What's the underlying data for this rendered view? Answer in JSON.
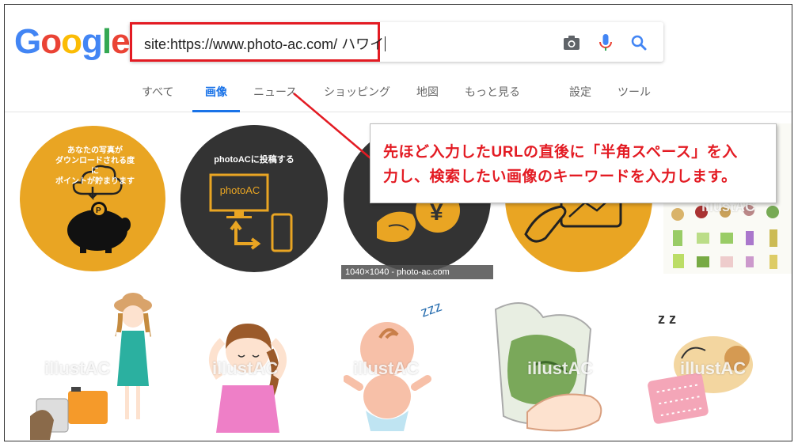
{
  "logo": {
    "letters": [
      "G",
      "o",
      "o",
      "g",
      "l",
      "e"
    ],
    "colors": [
      "#4285f4",
      "#ea4335",
      "#fbbc05",
      "#4285f4",
      "#34a853",
      "#ea4335"
    ]
  },
  "search": {
    "query": "site:https://www.photo-ac.com/ ハワイ"
  },
  "tabs": [
    {
      "label": "すべて",
      "active": false
    },
    {
      "label": "画像",
      "active": true
    },
    {
      "label": "ニュース",
      "active": false
    },
    {
      "label": "ショッピング",
      "active": false
    },
    {
      "label": "地図",
      "active": false
    },
    {
      "label": "もっと見る",
      "active": false
    },
    {
      "label": "設定",
      "active": false
    },
    {
      "label": "ツール",
      "active": false
    }
  ],
  "callout": {
    "line1": "先ほど入力したURLの直後に「半角スペース」を入",
    "line2": "力し、検索したい画像のキーワードを入力します。",
    "color": "#e31b23"
  },
  "results": {
    "tile1_caption": "あなたの写真が\nダウンロードされる度に\nポイントが貯まります",
    "tile2_caption": "photoACに投稿する",
    "tile2_screen": "photoAC",
    "dimension_tag": "1040×1040 - photo-ac.com",
    "watermark": "illustAC"
  },
  "colors": {
    "accent": "#1a73e8",
    "highlight": "#e31b23",
    "orange": "#e9a523",
    "dark": "#333333"
  }
}
